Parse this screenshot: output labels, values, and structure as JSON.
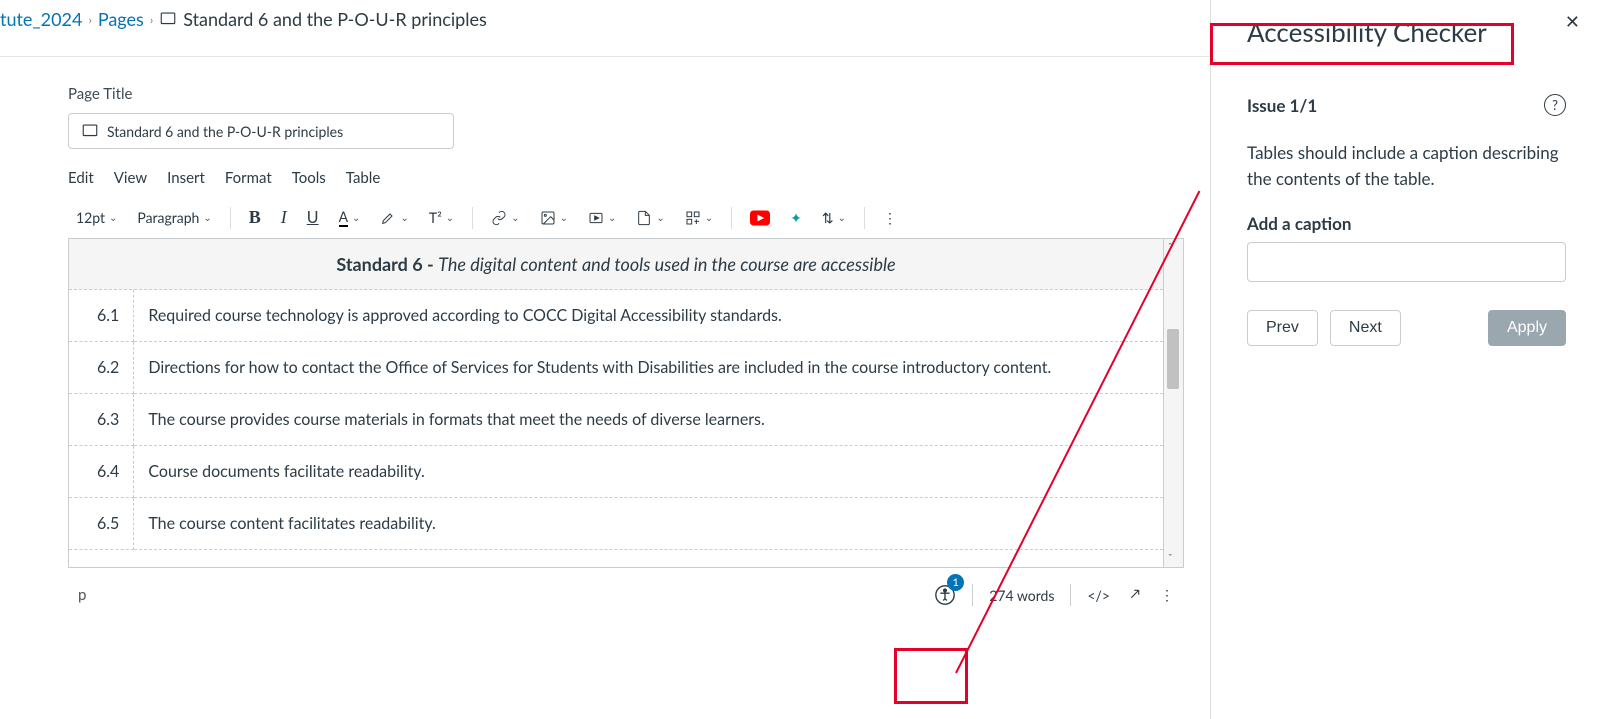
{
  "breadcrumbs": {
    "course_frag": "tute_2024",
    "pages": "Pages",
    "current": "Standard 6 and the P-O-U-R principles"
  },
  "editor": {
    "page_title_label": "Page Title",
    "page_title_value": "Standard 6 and the P-O-U-R principles",
    "menu": {
      "edit": "Edit",
      "view": "View",
      "insert": "Insert",
      "format": "Format",
      "tools": "Tools",
      "table": "Table"
    },
    "toolbar": {
      "font_size": "12pt",
      "block_format": "Paragraph",
      "superscript": "T²"
    },
    "content_header_prefix": "Standard 6 - ",
    "content_header_italic": "The digital content and tools used in the course are accessible",
    "rows": [
      {
        "num": "6.1",
        "text": "Required course technology is approved according to COCC Digital Accessibility standards."
      },
      {
        "num": "6.2",
        "text": "Directions for how to contact the Office of Services for Students with Disabilities are included in the course introductory content."
      },
      {
        "num": "6.3",
        "text": "The course provides course materials in formats that meet the needs of diverse learners."
      },
      {
        "num": "6.4",
        "text": "Course documents facilitate readability."
      },
      {
        "num": "6.5",
        "text": "The course content facilitates readability."
      }
    ],
    "status": {
      "path": "p",
      "a11y_count": "1",
      "words": "274 words",
      "code": "</>"
    }
  },
  "panel": {
    "title": "Accessibility Checker",
    "close": "✕",
    "issue_count": "Issue 1/1",
    "help": "?",
    "issue_text": "Tables should include a caption describing the contents of the table.",
    "caption_label": "Add a caption",
    "caption_value": "",
    "prev": "Prev",
    "next": "Next",
    "apply": "Apply"
  }
}
